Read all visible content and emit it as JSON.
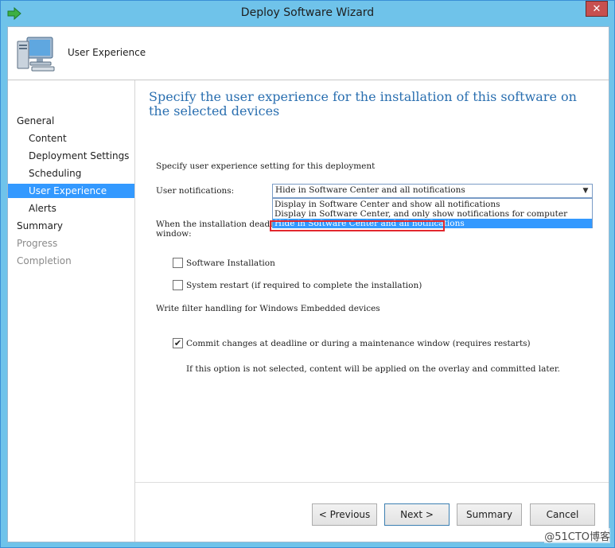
{
  "window": {
    "title": "Deploy Software Wizard",
    "close_label": "✕"
  },
  "header": {
    "title": "User Experience"
  },
  "nav": {
    "items": [
      {
        "label": "General",
        "level": 0,
        "state": "normal"
      },
      {
        "label": "Content",
        "level": 1,
        "state": "normal"
      },
      {
        "label": "Deployment Settings",
        "level": 1,
        "state": "normal"
      },
      {
        "label": "Scheduling",
        "level": 1,
        "state": "normal"
      },
      {
        "label": "User Experience",
        "level": 1,
        "state": "selected"
      },
      {
        "label": "Alerts",
        "level": 1,
        "state": "normal"
      },
      {
        "label": "Summary",
        "level": 0,
        "state": "normal"
      },
      {
        "label": "Progress",
        "level": 0,
        "state": "disabled"
      },
      {
        "label": "Completion",
        "level": 0,
        "state": "disabled"
      }
    ]
  },
  "content": {
    "heading": "Specify the user experience for the installation of this software on the selected devices",
    "section_label": "Specify user experience setting for this deployment",
    "notifications_label": "User notifications:",
    "notifications_value": "Hide in Software Center and all notifications",
    "notifications_options": [
      "Display in Software Center and show all notifications",
      "Display in Software Center, and only show notifications for computer restarts",
      "Hide in Software Center and all notifications"
    ],
    "deadline_label_line1": "When the installation deadline",
    "deadline_label_line2": "window:",
    "software_install_label": "Software Installation",
    "system_restart_label": "System restart  (if required to complete the installation)",
    "write_filter_label": "Write filter handling for Windows Embedded devices",
    "commit_label": "Commit changes at deadline or during a maintenance window (requires restarts)",
    "commit_note": "If this option is not selected, content will be applied on the overlay and committed later."
  },
  "checkboxes": {
    "software_installation": false,
    "system_restart": false,
    "commit_changes": true
  },
  "buttons": {
    "previous": "< Previous",
    "next": "Next >",
    "summary": "Summary",
    "cancel": "Cancel"
  },
  "watermark": "@51CTO博客",
  "colors": {
    "title_bar": "#6fc3ea",
    "selection": "#3399ff",
    "heading": "#2a6fb0",
    "highlight_box": "#e2282e"
  }
}
